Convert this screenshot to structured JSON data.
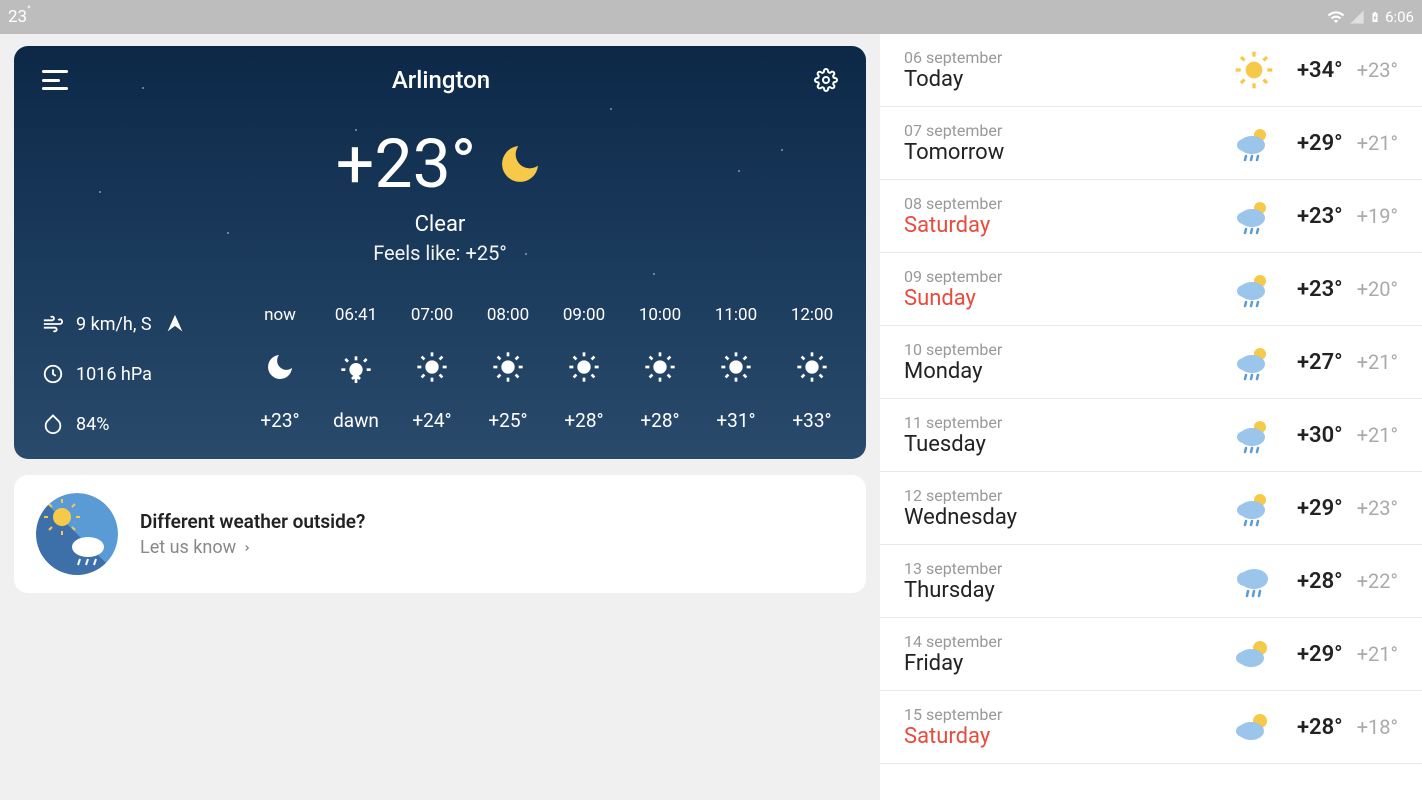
{
  "status": {
    "temp": "23",
    "time": "6:06"
  },
  "city": "Arlington",
  "current": {
    "temp": "+23°",
    "condition": "Clear",
    "feels": "Feels like: +25°"
  },
  "metrics": {
    "wind": "9 km/h, S",
    "pressure": "1016 hPa",
    "humidity": "84%"
  },
  "hourly": [
    {
      "time": "now",
      "icon": "moon",
      "temp": "+23°"
    },
    {
      "time": "06:41",
      "icon": "sunrise",
      "temp": "dawn"
    },
    {
      "time": "07:00",
      "icon": "sun",
      "temp": "+24°"
    },
    {
      "time": "08:00",
      "icon": "sun",
      "temp": "+25°"
    },
    {
      "time": "09:00",
      "icon": "sun",
      "temp": "+28°"
    },
    {
      "time": "10:00",
      "icon": "sun",
      "temp": "+28°"
    },
    {
      "time": "11:00",
      "icon": "sun",
      "temp": "+31°"
    },
    {
      "time": "12:00",
      "icon": "sun",
      "temp": "+33°"
    }
  ],
  "feedback": {
    "title": "Different weather outside?",
    "subtitle": "Let us know"
  },
  "daily": [
    {
      "date": "06 september",
      "name": "Today",
      "weekend": false,
      "icon": "sun",
      "high": "+34°",
      "low": "+23°"
    },
    {
      "date": "07 september",
      "name": "Tomorrow",
      "weekend": false,
      "icon": "rain-sun",
      "high": "+29°",
      "low": "+21°"
    },
    {
      "date": "08 september",
      "name": "Saturday",
      "weekend": true,
      "icon": "rain-sun",
      "high": "+23°",
      "low": "+19°"
    },
    {
      "date": "09 september",
      "name": "Sunday",
      "weekend": true,
      "icon": "rain-sun",
      "high": "+23°",
      "low": "+20°"
    },
    {
      "date": "10 september",
      "name": "Monday",
      "weekend": false,
      "icon": "rain-sun",
      "high": "+27°",
      "low": "+21°"
    },
    {
      "date": "11 september",
      "name": "Tuesday",
      "weekend": false,
      "icon": "rain-sun",
      "high": "+30°",
      "low": "+21°"
    },
    {
      "date": "12 september",
      "name": "Wednesday",
      "weekend": false,
      "icon": "rain-sun",
      "high": "+29°",
      "low": "+23°"
    },
    {
      "date": "13 september",
      "name": "Thursday",
      "weekend": false,
      "icon": "rain",
      "high": "+28°",
      "low": "+22°"
    },
    {
      "date": "14 september",
      "name": "Friday",
      "weekend": false,
      "icon": "partly",
      "high": "+29°",
      "low": "+21°"
    },
    {
      "date": "15 september",
      "name": "Saturday",
      "weekend": true,
      "icon": "partly",
      "high": "+28°",
      "low": "+18°"
    }
  ]
}
